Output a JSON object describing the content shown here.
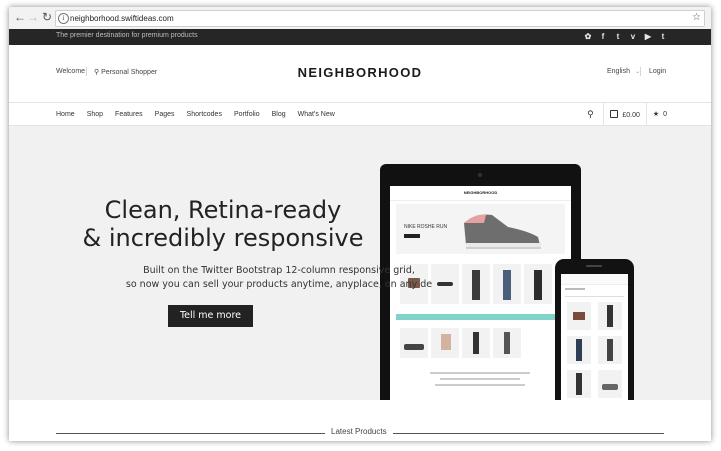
{
  "browser": {
    "url": "neighborhood.swiftideas.com",
    "back_icon": "arrow-left-icon",
    "forward_icon": "arrow-right-icon",
    "reload_icon": "reload-icon",
    "bookmark_icon": "star-outline-icon"
  },
  "topbar": {
    "tagline": "The premier destination for premium products",
    "social": [
      "dribbble-icon",
      "facebook-icon",
      "twitter-icon",
      "vimeo-icon",
      "youtube-icon",
      "tumblr-icon"
    ]
  },
  "header": {
    "welcome": "Welcome",
    "personal_shopper": "Personal Shopper",
    "logo": "NEIGHBORHOOD",
    "language": "English",
    "login": "Login"
  },
  "nav": {
    "items": [
      "Home",
      "Shop",
      "Features",
      "Pages",
      "Shortcodes",
      "Portfolio",
      "Blog",
      "What's New"
    ],
    "cart_total": "£0.00",
    "wishlist_count": "0"
  },
  "hero": {
    "headline_line1": "Clean, Retina-ready",
    "headline_line2": "& incredibly responsive",
    "subtext_line1": "Built on the Twitter Bootstrap 12-column responsive grid,",
    "subtext_line2": "so now you can sell your products anytime, anyplace, on any de",
    "cta": "Tell me more"
  },
  "mockup": {
    "tablet_logo": "NEIGHBORHOOD",
    "tablet_banner": "NIKE ROSHE RUN"
  },
  "latest": {
    "title": "Latest Products"
  },
  "colors": {
    "topbar": "#262626",
    "hero_bg": "#f1f1f1",
    "cta_bg": "#222222",
    "accent_teal": "#7fd3c9"
  }
}
